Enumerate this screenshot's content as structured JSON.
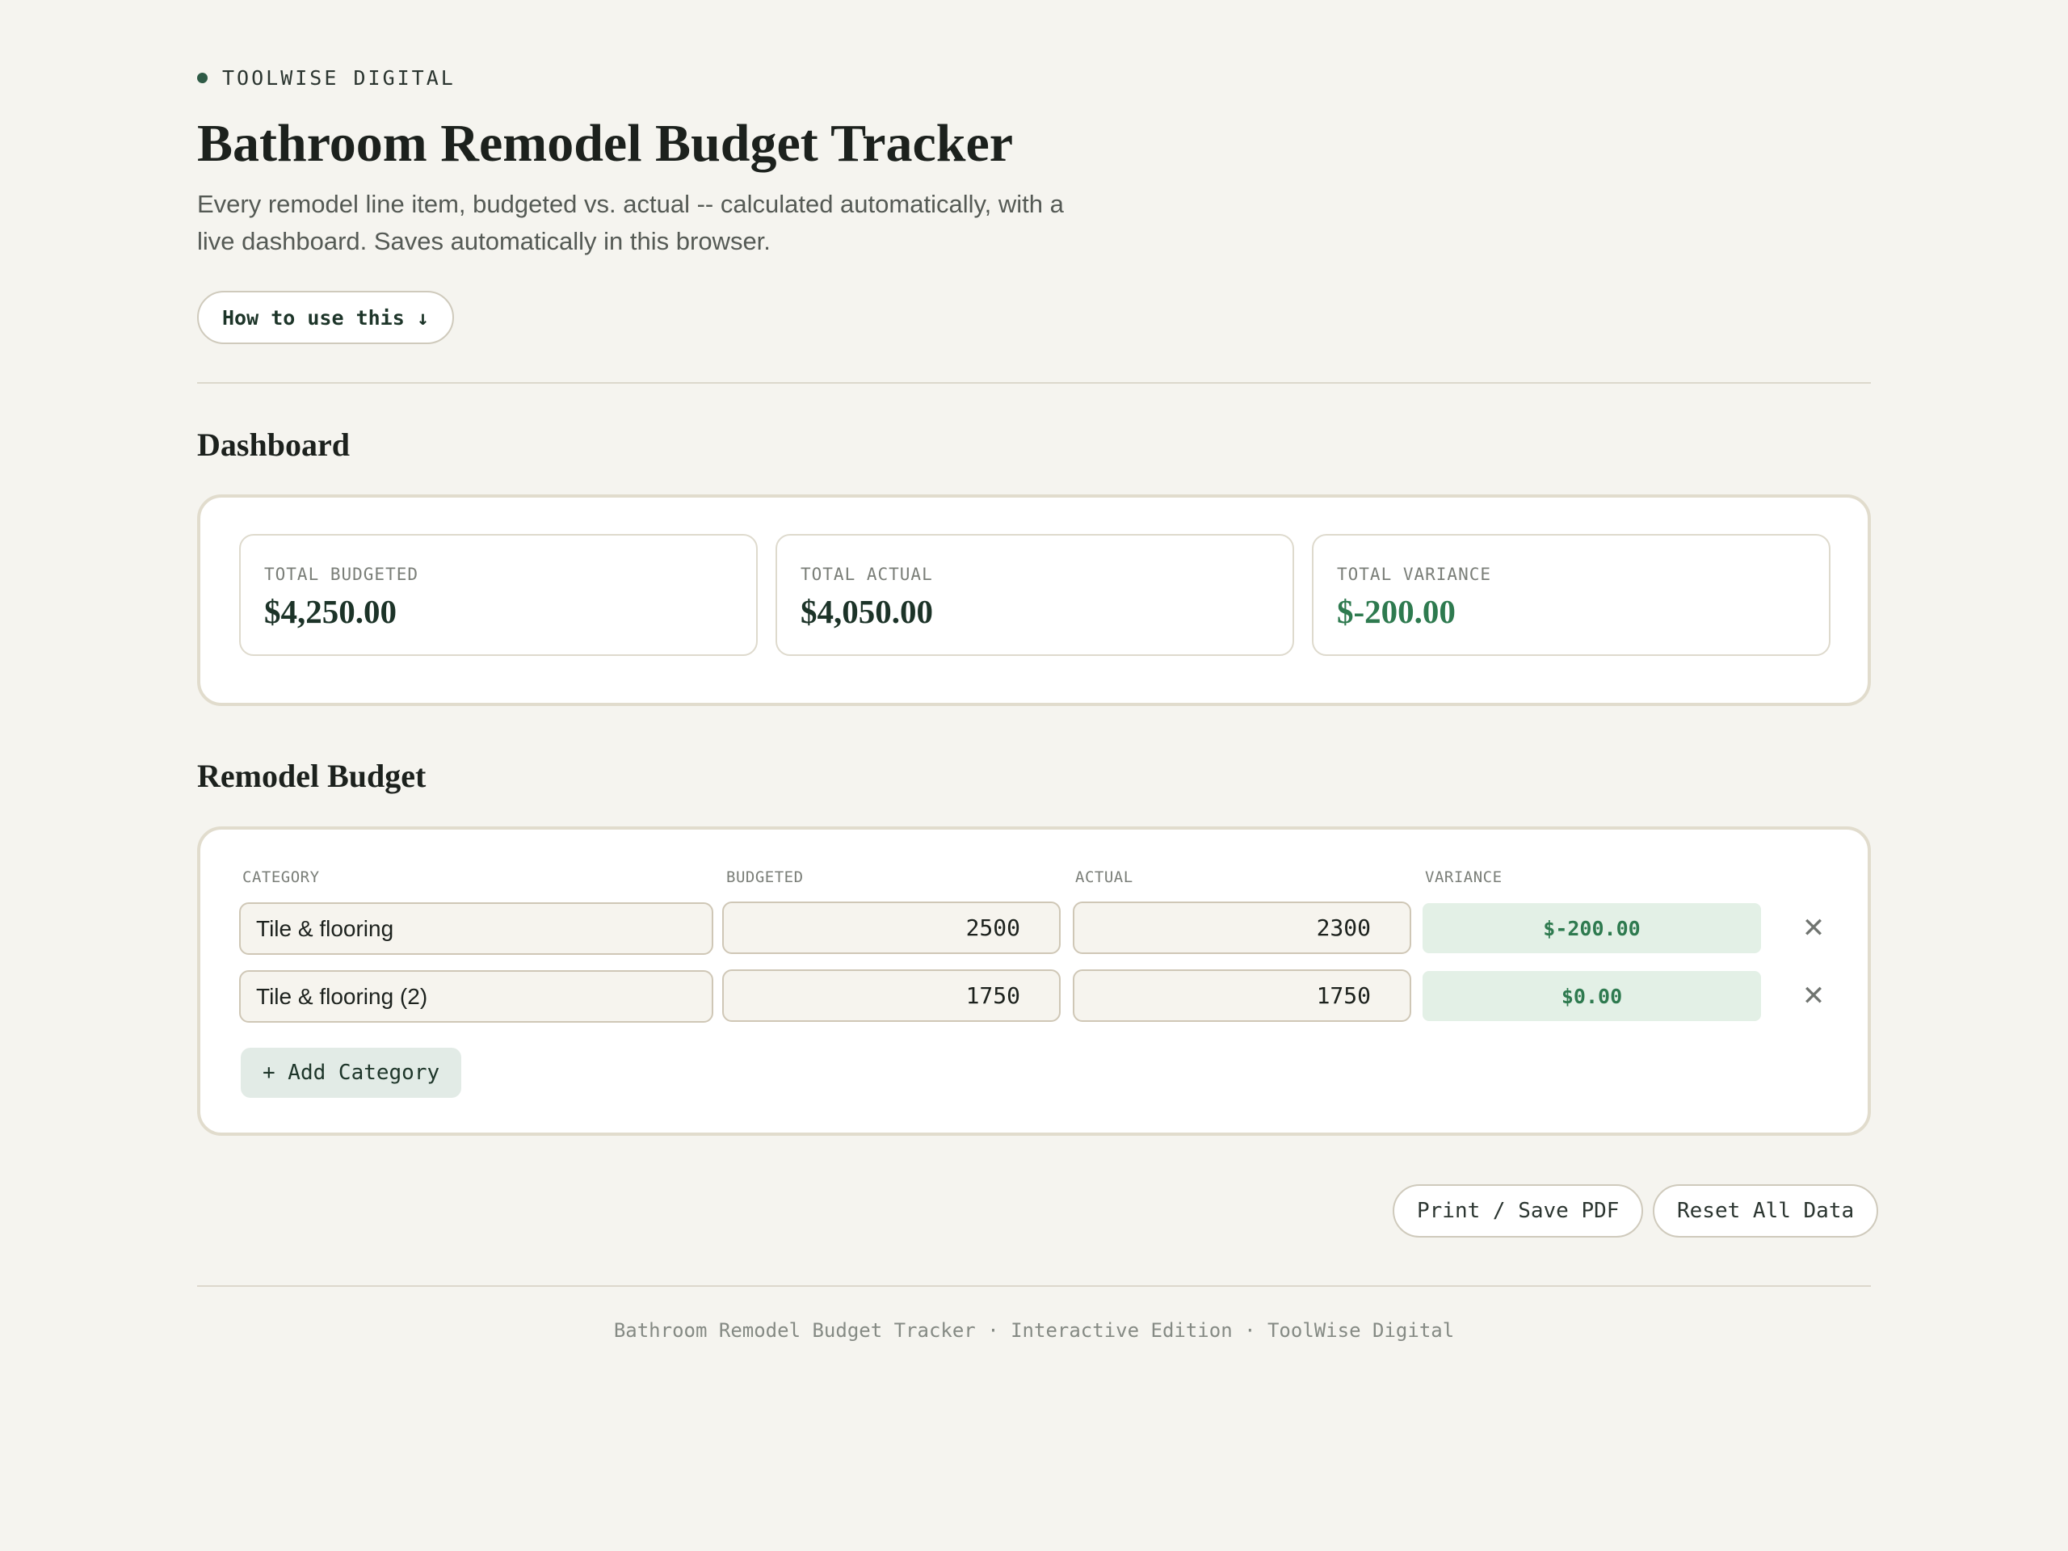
{
  "brand": {
    "name": "TOOLWISE DIGITAL"
  },
  "header": {
    "title": "Bathroom Remodel Budget Tracker",
    "subtitle": "Every remodel line item, budgeted vs. actual -- calculated automatically, with a live dashboard. Saves automatically in this browser.",
    "howto_label": "How to use this ↓"
  },
  "dashboard": {
    "heading": "Dashboard",
    "kpis": [
      {
        "label": "TOTAL BUDGETED",
        "value": "$4,250.00"
      },
      {
        "label": "TOTAL ACTUAL",
        "value": "$4,050.00"
      },
      {
        "label": "TOTAL VARIANCE",
        "value": "$-200.00"
      }
    ]
  },
  "budget": {
    "heading": "Remodel Budget",
    "columns": [
      "CATEGORY",
      "BUDGETED",
      "ACTUAL",
      "VARIANCE"
    ],
    "rows": [
      {
        "category": "Tile & flooring",
        "budgeted": "2500",
        "actual": "2300",
        "variance": "$-200.00"
      },
      {
        "category": "Tile & flooring (2)",
        "budgeted": "1750",
        "actual": "1750",
        "variance": "$0.00"
      }
    ],
    "delete_icon": "close-icon",
    "add_label": "+ Add Category"
  },
  "actions": {
    "print_label": "Print / Save PDF",
    "reset_label": "Reset All Data"
  },
  "footer": {
    "text": "Bathroom Remodel Budget Tracker · Interactive Edition · ToolWise Digital"
  },
  "colors": {
    "background": "#f5f4ef",
    "accent": "#2f5b46",
    "positive": "#2e7a4f",
    "variance_bg": "#e3f0e6"
  }
}
